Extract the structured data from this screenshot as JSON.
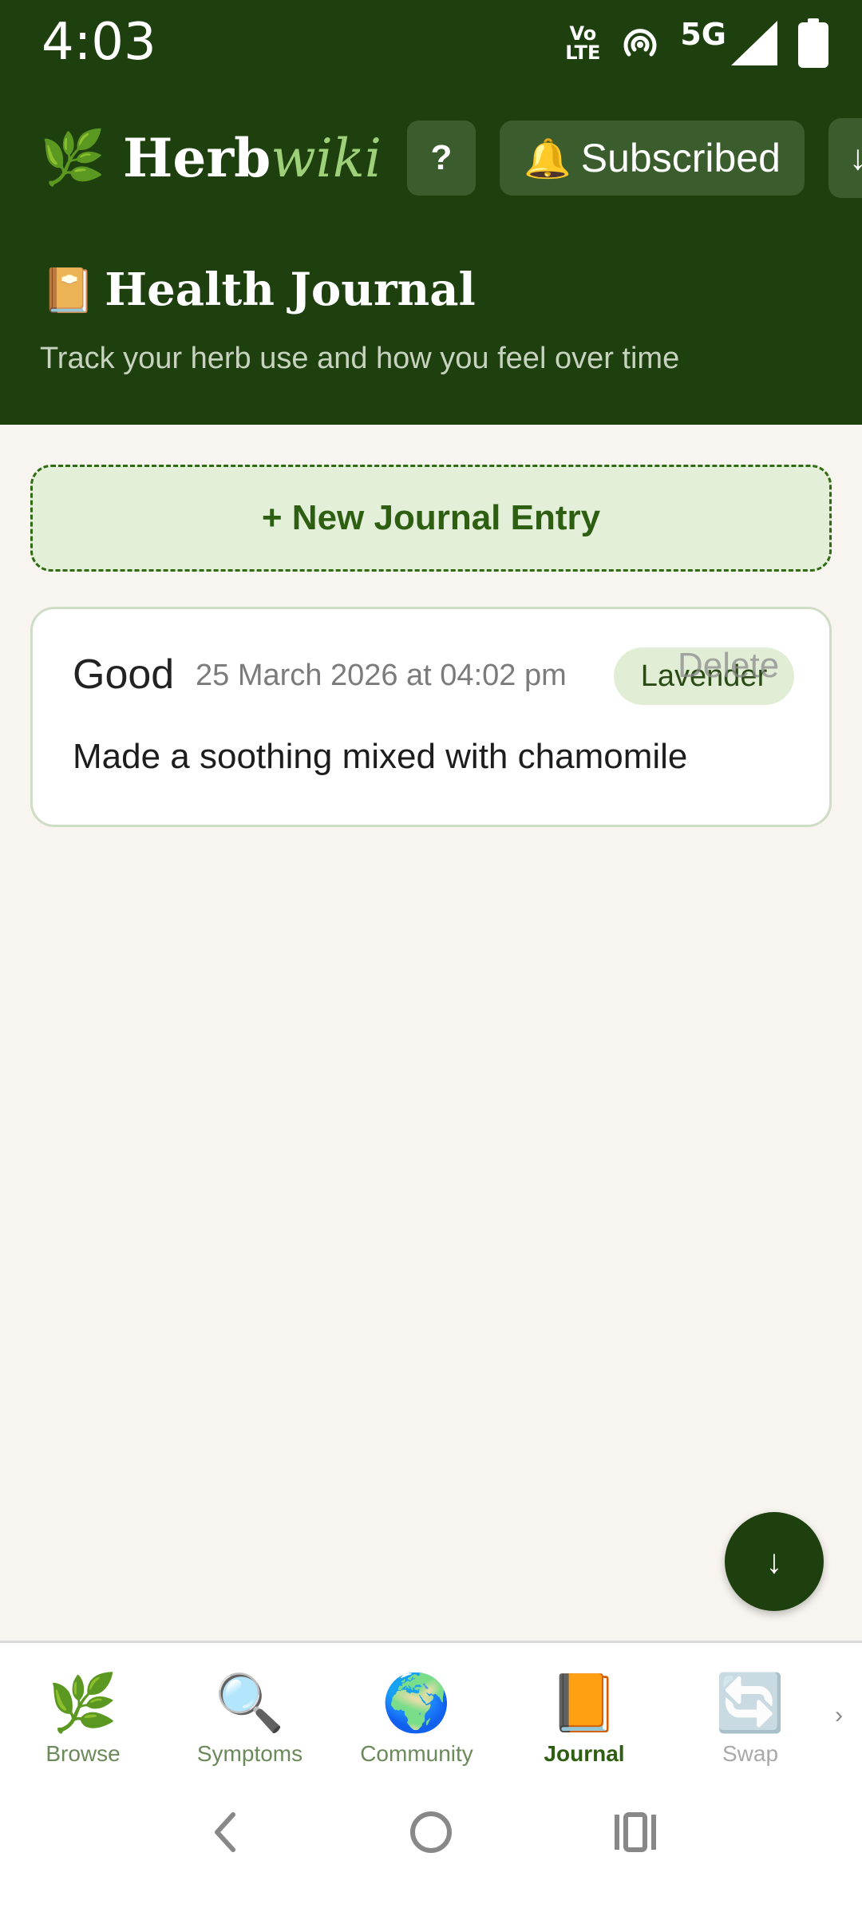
{
  "status_bar": {
    "time": "4:03",
    "volte_top": "Vo",
    "volte_bottom": "LTE",
    "network": "5G"
  },
  "header": {
    "logo_icon": "🌿",
    "logo_main": "Herb",
    "logo_accent": "wiki",
    "help_label": "?",
    "subscribe_icon": "🔔",
    "subscribe_label": "Subscribed",
    "download_label": "↓"
  },
  "page": {
    "icon": "📔",
    "title": "Health Journal",
    "subtitle": "Track your herb use and how you feel over time"
  },
  "new_entry_label": "+ New Journal Entry",
  "entries": [
    {
      "mood": "Good",
      "date": "25 March 2026 at 04:02 pm",
      "herb": "Lavender",
      "delete_label": "Delete",
      "note": "Made a soothing mixed with chamomile"
    }
  ],
  "fab_label": "↓",
  "nav": {
    "items": [
      {
        "icon": "🌿",
        "label": "Browse"
      },
      {
        "icon": "🔍",
        "label": "Symptoms"
      },
      {
        "icon": "🌍",
        "label": "Community"
      },
      {
        "icon": "📙",
        "label": "Journal"
      },
      {
        "icon": "🔄",
        "label": "Swap"
      }
    ],
    "active": "Journal",
    "more_label": "›"
  },
  "colors": {
    "header_bg": "#1e3f0e",
    "accent_green": "#2e5e12",
    "logo_accent": "#9ed07a",
    "page_bg": "#f8f5f0"
  }
}
